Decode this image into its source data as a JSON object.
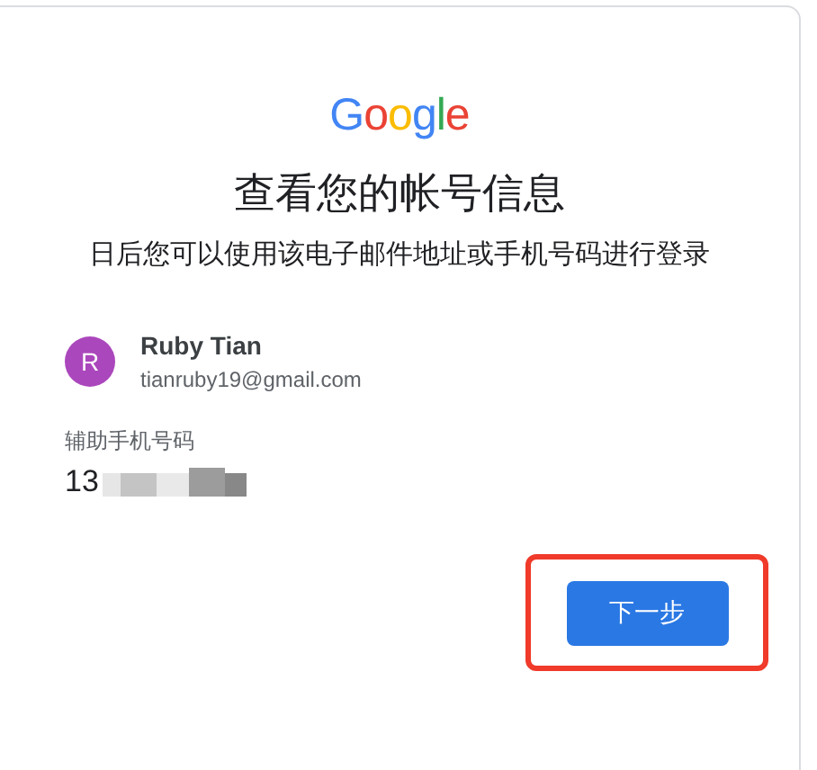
{
  "logo": "Google",
  "title": "查看您的帐号信息",
  "subtitle": "日后您可以使用该电子邮件地址或手机号码进行登录",
  "account": {
    "initial": "R",
    "name": "Ruby Tian",
    "email": "tianruby19@gmail.com"
  },
  "recovery_phone": {
    "label": "辅助手机号码",
    "value": "13"
  },
  "next_button": {
    "label": "下一步"
  }
}
